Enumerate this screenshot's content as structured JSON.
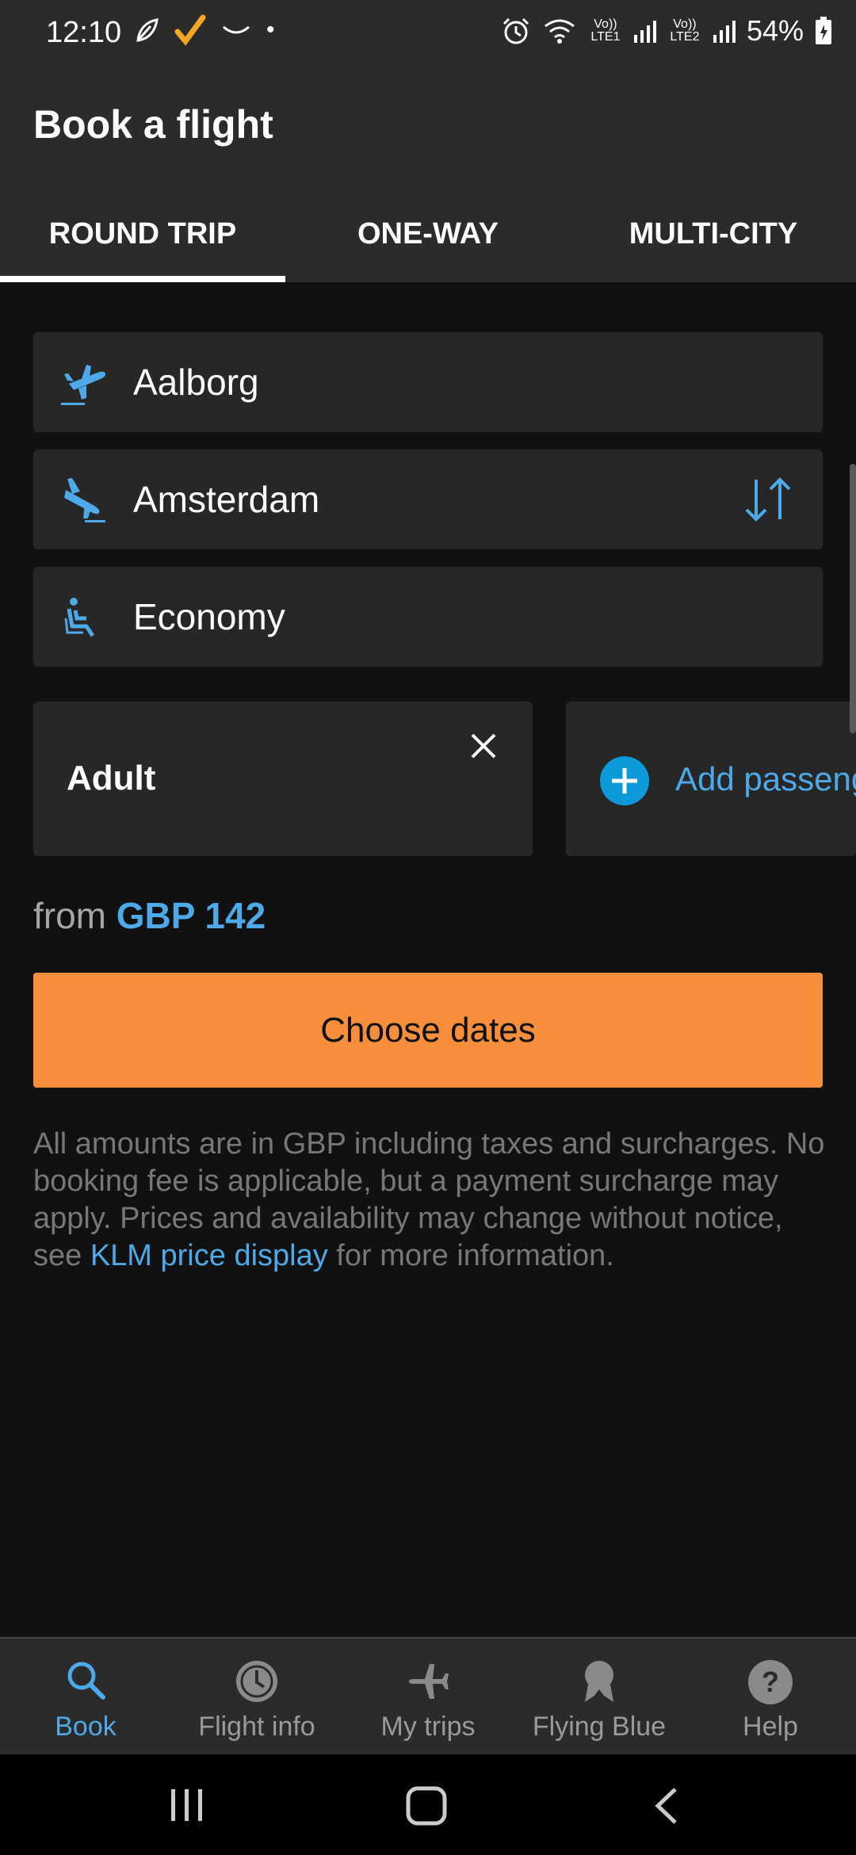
{
  "status_bar": {
    "time": "12:10",
    "sim1": "Vo)) LTE1",
    "sim2": "Vo)) LTE2",
    "battery": "54%"
  },
  "header": {
    "title": "Book a flight"
  },
  "tabs": [
    {
      "label": "ROUND TRIP",
      "active": true
    },
    {
      "label": "ONE-WAY",
      "active": false
    },
    {
      "label": "MULTI-CITY",
      "active": false
    }
  ],
  "form": {
    "origin": "Aalborg",
    "destination": "Amsterdam",
    "cabin_class": "Economy",
    "passenger_chip": "Adult",
    "add_passenger_label": "Add passeng"
  },
  "price": {
    "prefix": "from",
    "amount": "GBP 142"
  },
  "cta": {
    "label": "Choose dates"
  },
  "disclaimer": {
    "text_before": "All amounts are in GBP including taxes and surcharges. No booking fee is applicable, but a payment surcharge may apply. Prices and availability may change without notice, see ",
    "link": "KLM price display",
    "text_after": " for more information."
  },
  "bottom_nav": [
    {
      "label": "Book",
      "icon": "search-icon",
      "active": true
    },
    {
      "label": "Flight info",
      "icon": "clock-icon",
      "active": false
    },
    {
      "label": "My trips",
      "icon": "plane-icon",
      "active": false
    },
    {
      "label": "Flying Blue",
      "icon": "medal-icon",
      "active": false
    },
    {
      "label": "Help",
      "icon": "help-icon",
      "active": false
    }
  ],
  "colors": {
    "accent": "#4da9e8",
    "cta": "#f78e3c",
    "background": "#111111",
    "surface": "#272727"
  }
}
